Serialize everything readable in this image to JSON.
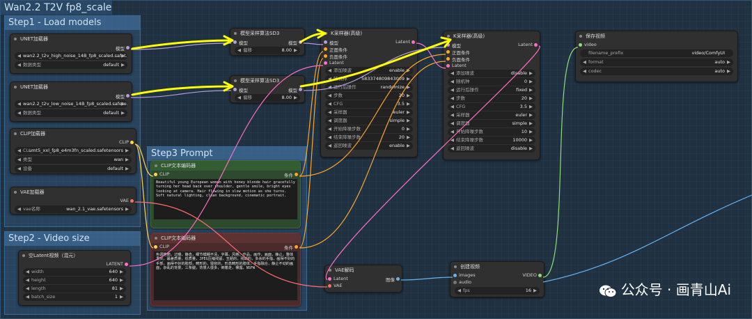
{
  "workflow_title": "Wan2.2 T2V fp8_scaled",
  "groups": {
    "load_models": "Step1 - Load models",
    "prompt": "Step3 Prompt",
    "video_size": "Step2 - Video size"
  },
  "unet1": {
    "title": "UNET加载器",
    "out_label": "模型",
    "unet_name": "wan2.2_t2v_high_noise_14B_fp8_scaled.safet...",
    "dtype_label": "数据类型",
    "dtype_value": "default"
  },
  "unet2": {
    "title": "UNET加载器",
    "out_label": "模型",
    "unet_name": "wan2.2_t2v_low_noise_14B_fp8_scaled.safete...",
    "dtype_label": "数据类型",
    "dtype_value": "default"
  },
  "clip_loader": {
    "title": "CLIP加载器",
    "out_label": "CLIP",
    "clip_label": "CLI...",
    "clip_value": "umt5_xxl_fp8_e4m3fn_scaled.safetensors",
    "type_label": "类型",
    "type_value": "wan",
    "device_label": "设备",
    "device_value": "default"
  },
  "vae_loader": {
    "title": "VAE加载器",
    "out_label": "VAE",
    "vae_label": "vae名称",
    "vae_value": "wan_2.1_vae.safetensors"
  },
  "latent": {
    "title": "空Latent视频（混元）",
    "out_label": "LATENT",
    "width_label": "width",
    "width_value": "640",
    "height_label": "height",
    "height_value": "640",
    "length_label": "length",
    "length_value": "81",
    "batch_label": "batch_size",
    "batch_value": "1"
  },
  "sd3_1": {
    "title": "模型采样算法SD3",
    "in_label": "模型",
    "out_label": "模型",
    "shift_label": "偏移",
    "shift_value": "8.00"
  },
  "sd3_2": {
    "title": "模型采样算法SD3",
    "in_label": "模型",
    "out_label": "模型",
    "shift_label": "偏移",
    "shift_value": "8.00"
  },
  "ksampler1": {
    "title": "K采样器(高级)",
    "inputs": [
      "模型",
      "正面条件",
      "负面条件",
      "Latent"
    ],
    "out_label": "Latent",
    "widgets": [
      {
        "label": "添加噪波",
        "value": "enable"
      },
      {
        "label": "随机种",
        "value": "583374809843009"
      },
      {
        "label": "运行后操作",
        "value": "randomize"
      },
      {
        "label": "步数",
        "value": "20"
      },
      {
        "label": "CFG",
        "value": "3.5"
      },
      {
        "label": "采样器",
        "value": "euler"
      },
      {
        "label": "调度器",
        "value": "simple"
      },
      {
        "label": "开始降噪步数",
        "value": "0"
      },
      {
        "label": "结束降噪步数",
        "value": "20"
      },
      {
        "label": "返回噪波",
        "value": "enable"
      }
    ]
  },
  "ksampler2": {
    "title": "K采样器(高级)",
    "inputs": [
      "模型",
      "正面条件",
      "负面条件",
      "Latent"
    ],
    "out_label": "Latent",
    "widgets": [
      {
        "label": "添加噪波",
        "value": "disable"
      },
      {
        "label": "随机种",
        "value": "0"
      },
      {
        "label": "运行后操作",
        "value": "fixed"
      },
      {
        "label": "步数",
        "value": "20"
      },
      {
        "label": "CFG",
        "value": "3.5"
      },
      {
        "label": "采样器",
        "value": "euler"
      },
      {
        "label": "调度器",
        "value": "simple"
      },
      {
        "label": "开始降噪步数",
        "value": "10"
      },
      {
        "label": "结束降噪步数",
        "value": "10000"
      },
      {
        "label": "返回噪波",
        "value": "disable"
      }
    ]
  },
  "clip_pos": {
    "title": "CLIP文本编码器",
    "in_label": "CLIP",
    "out_label": "条件",
    "text": "Beautiful young European woman with honey blonde hair gracefully turning her head back over shoulder, gentle smile, bright eyes looking at camera. Hair flowing in slow motion as she turns. Soft natural lighting, clean background, cinematic portrait."
  },
  "clip_neg": {
    "title": "CLIP文本编码器",
    "in_label": "CLIP",
    "out_label": "条件",
    "text": "色调艳丽，过曝，静态，细节模糊不清，字幕，风格，作品，画作，画面，静止，整体发灰，最差质量，低质量，JPEG压缩残留，丑陋的，残缺的，多余的手指，画得不好的手部，画得不好的脸部，畸形的，毁容的，形态畸形的肢体，手指融合，静止不动的画面，杂乱的背景，三条腿，背景人很多，倒着走，裸露，NSFW"
  },
  "vae_decode": {
    "title": "VAE解码",
    "in1": "Latent",
    "in2": "VAE",
    "out_label": "图像"
  },
  "create_video": {
    "title": "创建视频",
    "in1": "images",
    "in2": "audio",
    "out_label": "VIDEO",
    "fps_label": "fps",
    "fps_value": "16"
  },
  "save_video": {
    "title": "保存视频",
    "in_label": "video",
    "prefix_label": "filename_prefix",
    "prefix_value": "video/ComfyUI",
    "format_label": "format",
    "format_value": "auto",
    "codec_label": "codec",
    "codec_value": "auto"
  },
  "watermark": "公众号 · 画青山Ai",
  "colors": {
    "model": "#b39ddb",
    "clip": "#ffd54f",
    "conditioning": "#ffa726",
    "latent": "#ff6ec7",
    "vae": "#ff6b6b",
    "image": "#64b5f6",
    "video": "#8ee07a",
    "annotation": "#ffff00"
  }
}
